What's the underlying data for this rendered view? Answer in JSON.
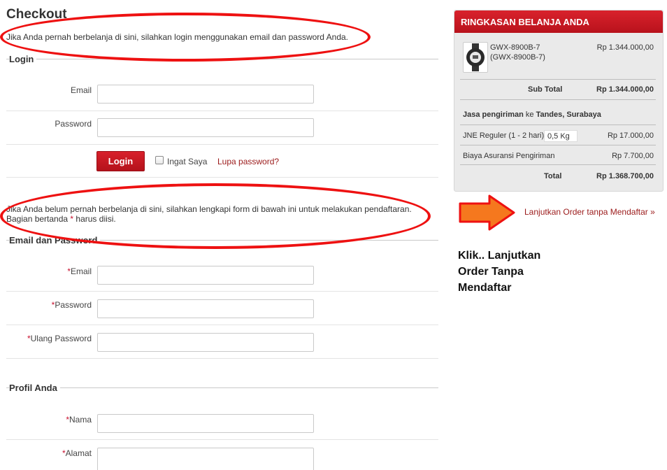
{
  "page": {
    "title": "Checkout",
    "login_intro": "Jika Anda pernah berbelanja di sini, silahkan login menggunakan email dan password Anda.",
    "register_intro_1": "Jika Anda belum pernah berbelanja di sini, silahkan lengkapi form di bawah ini untuk melakukan pendaftaran.",
    "register_intro_2a": "Bagian bertanda ",
    "register_intro_star": "*",
    "register_intro_2b": " harus diisi."
  },
  "login": {
    "section": "Login",
    "email_label": "Email",
    "password_label": "Password",
    "email_value": "",
    "password_value": "",
    "button": "Login",
    "remember": "Ingat Saya",
    "forgot": "Lupa password?"
  },
  "account": {
    "section": "Email dan Password",
    "req": "*",
    "email_label": "Email",
    "password_label": "Password",
    "repeat_label": "Ulang Password"
  },
  "profile": {
    "section": "Profil Anda",
    "name_label": "Nama",
    "address_label": "Alamat"
  },
  "summary": {
    "title": "RINGKASAN BELANJA ANDA",
    "product_name": "GWX-8900B-7",
    "product_code": "(GWX-8900B-7)",
    "product_price": "Rp 1.344.000,00",
    "subtotal_label": "Sub Total",
    "subtotal_value": "Rp 1.344.000,00",
    "shipping_label": "Jasa pengiriman",
    "shipping_to": " ke ",
    "shipping_dest": "Tandes, Surabaya",
    "courier": "JNE Reguler (1 - 2 hari)",
    "weight": "0,5 Kg",
    "courier_price": "Rp 17.000,00",
    "insurance_label": "Biaya Asuransi Pengiriman",
    "insurance_value": "Rp 7.700,00",
    "total_label": "Total",
    "total_value": "Rp 1.368.700,00"
  },
  "continue_link": "Lanjutkan Order tanpa Mendaftar »",
  "note_line1": "Klik.. Lanjutkan",
  "note_line2": "Order Tanpa",
  "note_line3": "Mendaftar",
  "colors": {
    "accent": "#c8161f",
    "arrow": "#f5781e",
    "annotation": "#e81111"
  }
}
